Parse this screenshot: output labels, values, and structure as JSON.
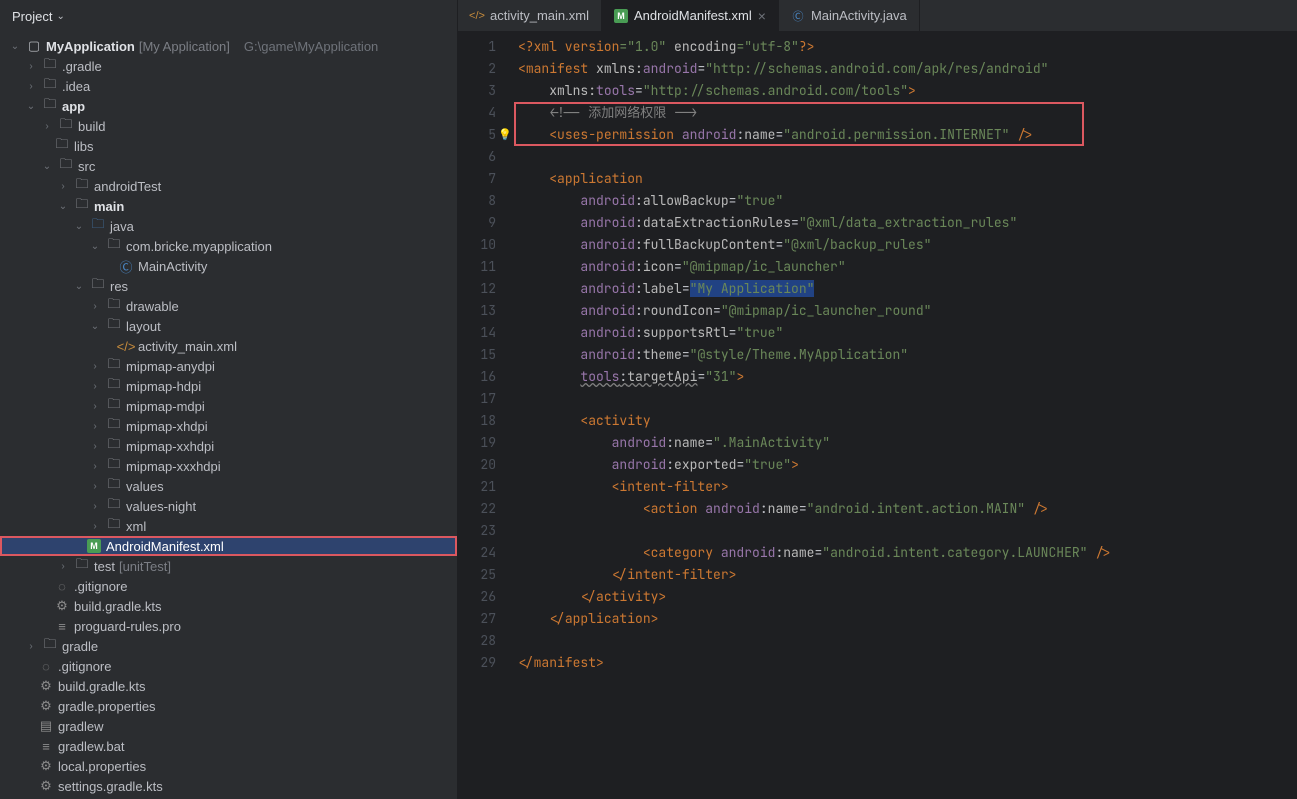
{
  "sidebar": {
    "title": "Project",
    "root": {
      "name": "MyApplication",
      "bracket": "[My Application]",
      "path": "G:\\game\\MyApplication"
    },
    "nodes": {
      "gradle_dir": ".gradle",
      "idea_dir": ".idea",
      "app": "app",
      "build": "build",
      "libs": "libs",
      "src": "src",
      "androidTest": "androidTest",
      "main": "main",
      "java": "java",
      "pkg": "com.bricke.myapplication",
      "mainActivity": "MainActivity",
      "res": "res",
      "drawable": "drawable",
      "layout": "layout",
      "activity_main": "activity_main.xml",
      "mipmap_anydpi": "mipmap-anydpi",
      "mipmap_hdpi": "mipmap-hdpi",
      "mipmap_mdpi": "mipmap-mdpi",
      "mipmap_xhdpi": "mipmap-xhdpi",
      "mipmap_xxhdpi": "mipmap-xxhdpi",
      "mipmap_xxxhdpi": "mipmap-xxxhdpi",
      "values": "values",
      "values_night": "values-night",
      "xml": "xml",
      "manifest": "AndroidManifest.xml",
      "test": "test",
      "test_bracket": "[unitTest]",
      "gitignore": ".gitignore",
      "build_gradle": "build.gradle.kts",
      "proguard": "proguard-rules.pro",
      "gradle": "gradle",
      "gitignore2": ".gitignore",
      "build_gradle2": "build.gradle.kts",
      "gradle_props": "gradle.properties",
      "gradlew": "gradlew",
      "gradlew_bat": "gradlew.bat",
      "local_props": "local.properties",
      "settings_gradle": "settings.gradle.kts"
    }
  },
  "tabs": [
    {
      "label": "activity_main.xml",
      "icon": "xml"
    },
    {
      "label": "AndroidManifest.xml",
      "icon": "manifest",
      "active": true
    },
    {
      "label": "MainActivity.java",
      "icon": "java"
    }
  ],
  "code": {
    "lines": 29,
    "text": {
      "l1_a": "<?",
      "l1_b": "xml version",
      "l1_c": "=\"1.0\"",
      "l1_d": " encoding",
      "l1_e": "=\"utf-8\"",
      "l1_f": "?>",
      "l2_a": "<",
      "l2_b": "manifest ",
      "l2_c": "xmlns:",
      "l2_d": "android",
      "l2_e": "=",
      "l2_f": "\"http://schemas.android.com/apk/res/android\"",
      "l3_a": "xmlns:",
      "l3_b": "tools",
      "l3_c": "=",
      "l3_d": "\"http://schemas.android.com/tools\"",
      "l3_e": ">",
      "l4": "<!-- 添加网络权限 -->",
      "l5_a": "<",
      "l5_b": "uses-permission ",
      "l5_c": "android",
      "l5_d": ":",
      "l5_e": "name",
      "l5_f": "=",
      "l5_g": "\"android.permission.INTERNET\"",
      "l5_h": " />",
      "l7_a": "<",
      "l7_b": "application",
      "l8_a": "android",
      "l8_b": ":",
      "l8_c": "allowBackup",
      "l8_d": "=",
      "l8_e": "\"true\"",
      "l9_a": "android",
      "l9_b": ":",
      "l9_c": "dataExtractionRules",
      "l9_d": "=",
      "l9_e": "\"@xml/data_extraction_rules\"",
      "l10_a": "android",
      "l10_b": ":",
      "l10_c": "fullBackupContent",
      "l10_d": "=",
      "l10_e": "\"@xml/backup_rules\"",
      "l11_a": "android",
      "l11_b": ":",
      "l11_c": "icon",
      "l11_d": "=",
      "l11_e": "\"@mipmap/ic_launcher\"",
      "l12_a": "android",
      "l12_b": ":",
      "l12_c": "label",
      "l12_d": "=",
      "l12_e": "\"My Application\"",
      "l13_a": "android",
      "l13_b": ":",
      "l13_c": "roundIcon",
      "l13_d": "=",
      "l13_e": "\"@mipmap/ic_launcher_round\"",
      "l14_a": "android",
      "l14_b": ":",
      "l14_c": "supportsRtl",
      "l14_d": "=",
      "l14_e": "\"true\"",
      "l15_a": "android",
      "l15_b": ":",
      "l15_c": "theme",
      "l15_d": "=",
      "l15_e": "\"@style/Theme.MyApplication\"",
      "l16_a": "tools",
      "l16_b": ":",
      "l16_c": "targetApi",
      "l16_d": "=",
      "l16_e": "\"31\"",
      "l16_f": ">",
      "l18_a": "<",
      "l18_b": "activity",
      "l19_a": "android",
      "l19_b": ":",
      "l19_c": "name",
      "l19_d": "=",
      "l19_e": "\".MainActivity\"",
      "l20_a": "android",
      "l20_b": ":",
      "l20_c": "exported",
      "l20_d": "=",
      "l20_e": "\"true\"",
      "l20_f": ">",
      "l21_a": "<",
      "l21_b": "intent-filter",
      "l21_c": ">",
      "l22_a": "<",
      "l22_b": "action ",
      "l22_c": "android",
      "l22_d": ":",
      "l22_e": "name",
      "l22_f": "=",
      "l22_g": "\"android.intent.action.MAIN\"",
      "l22_h": " />",
      "l24_a": "<",
      "l24_b": "category ",
      "l24_c": "android",
      "l24_d": ":",
      "l24_e": "name",
      "l24_f": "=",
      "l24_g": "\"android.intent.category.LAUNCHER\"",
      "l24_h": " />",
      "l25_a": "</",
      "l25_b": "intent-filter",
      "l25_c": ">",
      "l26_a": "</",
      "l26_b": "activity",
      "l26_c": ">",
      "l27_a": "</",
      "l27_b": "application",
      "l27_c": ">",
      "l29_a": "</",
      "l29_b": "manifest",
      "l29_c": ">"
    }
  }
}
